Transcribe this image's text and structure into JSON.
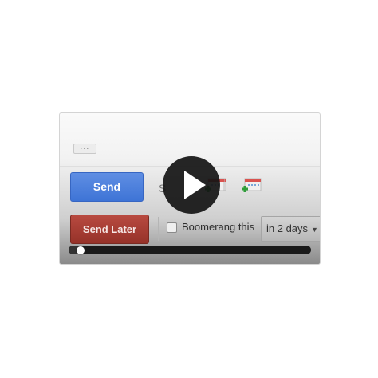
{
  "toolbar": {
    "ellipsis_label": "···",
    "send_label": "Send",
    "send_later_label": "Send Later",
    "partial_glyph": "S"
  },
  "boomerang": {
    "checkbox_checked": false,
    "label": "Boomerang this",
    "selected_option": "in 2 days"
  },
  "player": {
    "progress": 0.05
  },
  "icons": {
    "play": "play-icon",
    "calendar": "calendar-add-icon",
    "dropdown": "chevron-down-icon"
  },
  "colors": {
    "send": "#3e74d6",
    "send_later": "#963229",
    "calendar_plus": "#2f9e3a",
    "calendar_top": "#d9534f"
  }
}
